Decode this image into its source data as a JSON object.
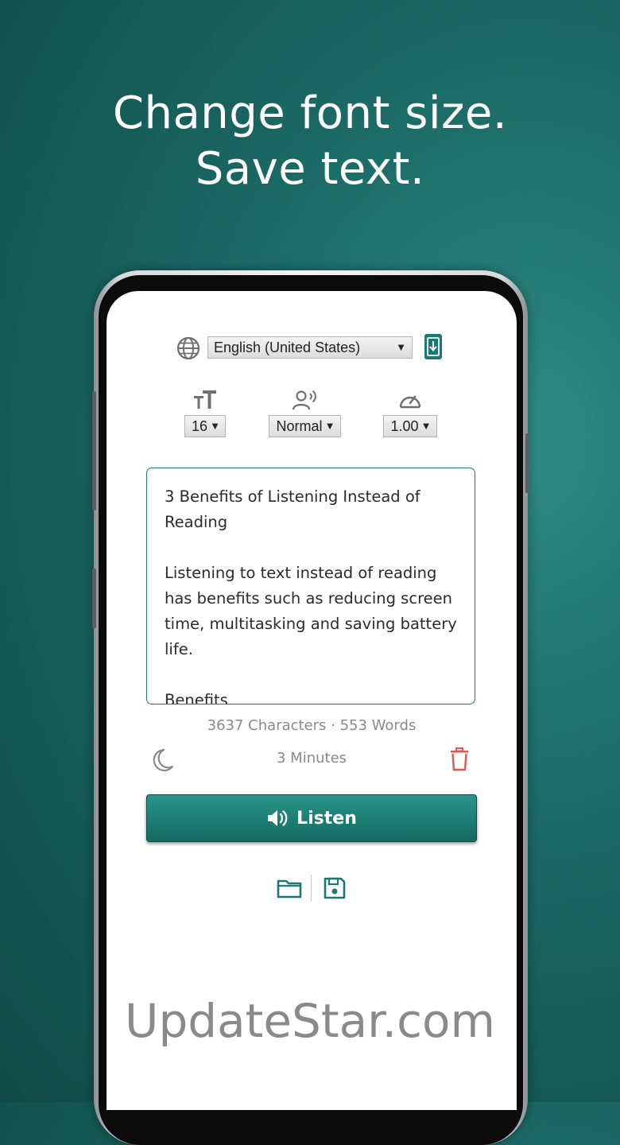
{
  "headline": {
    "line1": "Change font size.",
    "line2": "Save text."
  },
  "language": {
    "selected": "English (United States)",
    "arrow": "▼"
  },
  "controls": {
    "font_size": "16",
    "voice": "Normal",
    "speed": "1.00",
    "arrow": "▼"
  },
  "editor": {
    "text": "3 Benefits of Listening Instead of Reading\n\nListening to text instead of reading has benefits such as reducing screen time, multitasking and saving battery life.\n\nBenefits"
  },
  "stats": {
    "summary": "3637 Characters · 553 Words",
    "duration": "3 Minutes"
  },
  "listen_button": {
    "label": "Listen"
  },
  "watermark": "UpdateStar.com",
  "colors": {
    "accent": "#1a7a70",
    "background": "#1d6e69",
    "danger": "#e0574f",
    "muted_text": "#8a8a8a"
  },
  "icons": [
    "globe-icon",
    "download-icon",
    "font-size-icon",
    "voice-icon",
    "speed-icon",
    "moon-icon",
    "trash-icon",
    "speaker-icon",
    "folder-icon",
    "save-icon"
  ]
}
